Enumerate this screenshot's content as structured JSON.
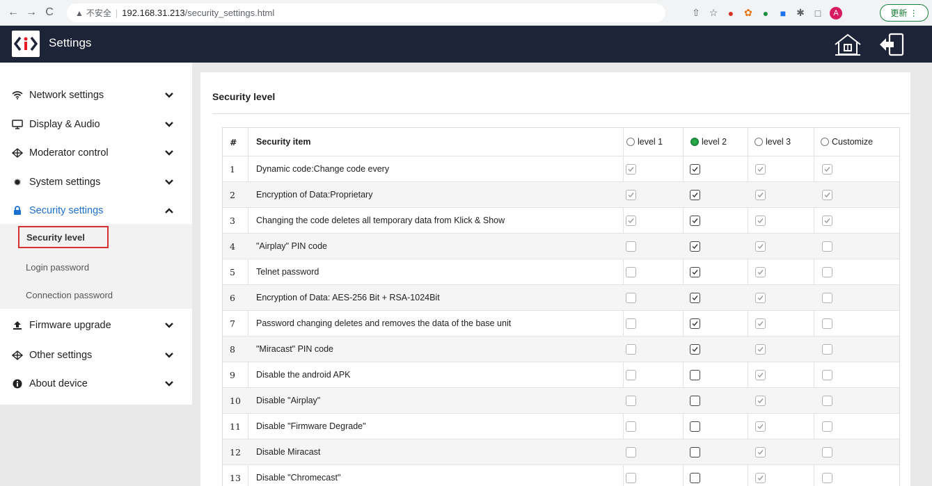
{
  "browser": {
    "security_warning": "不安全",
    "url_host": "192.168.31.213",
    "url_path": "/security_settings.html",
    "profile_initial": "A",
    "update_label": "更新"
  },
  "app": {
    "title": "Settings",
    "logo_text": "<i>"
  },
  "sidebar": {
    "items": [
      {
        "label": "Network settings",
        "icon": "wifi-icon"
      },
      {
        "label": "Display & Audio",
        "icon": "monitor-icon"
      },
      {
        "label": "Moderator control",
        "icon": "diamond-arrows-icon"
      },
      {
        "label": "System settings",
        "icon": "gear-icon"
      },
      {
        "label": "Security settings",
        "icon": "lock-icon"
      },
      {
        "label": "Firmware upgrade",
        "icon": "upload-icon"
      },
      {
        "label": "Other settings",
        "icon": "diamond-arrows-icon"
      },
      {
        "label": "About device",
        "icon": "info-icon"
      }
    ],
    "security_sub": [
      {
        "label": "Security level"
      },
      {
        "label": "Login password"
      },
      {
        "label": "Connection password"
      }
    ]
  },
  "main": {
    "title": "Security level",
    "columns": {
      "num": "#",
      "item": "Security item",
      "level1": "level 1",
      "level2": "level 2",
      "level3": "level 3",
      "custom": "Customize"
    },
    "selected_level": "level 2",
    "rows": [
      {
        "num": "1",
        "item": "Dynamic code:Change code every",
        "l1": true,
        "l2": true,
        "l3": true,
        "custom": true
      },
      {
        "num": "2",
        "item": "Encryption of Data:Proprietary",
        "l1": true,
        "l2": true,
        "l3": true,
        "custom": true
      },
      {
        "num": "3",
        "item": "Changing the code deletes all temporary data from Klick & Show",
        "l1": true,
        "l2": true,
        "l3": true,
        "custom": true
      },
      {
        "num": "4",
        "item": "\"Airplay\" PIN code",
        "l1": false,
        "l2": true,
        "l3": true,
        "custom": false
      },
      {
        "num": "5",
        "item": "Telnet password",
        "l1": false,
        "l2": true,
        "l3": true,
        "custom": false
      },
      {
        "num": "6",
        "item": "Encryption of Data: AES-256 Bit + RSA-1024Bit",
        "l1": false,
        "l2": true,
        "l3": true,
        "custom": false
      },
      {
        "num": "7",
        "item": "Password changing deletes and removes the data of the base unit",
        "l1": false,
        "l2": true,
        "l3": true,
        "custom": false
      },
      {
        "num": "8",
        "item": "\"Miracast\" PIN code",
        "l1": false,
        "l2": true,
        "l3": true,
        "custom": false
      },
      {
        "num": "9",
        "item": "Disable the android APK",
        "l1": false,
        "l2": false,
        "l3": true,
        "custom": false
      },
      {
        "num": "10",
        "item": "Disable \"Airplay\"",
        "l1": false,
        "l2": false,
        "l3": true,
        "custom": false
      },
      {
        "num": "11",
        "item": "Disable \"Firmware Degrade\"",
        "l1": false,
        "l2": false,
        "l3": true,
        "custom": false
      },
      {
        "num": "12",
        "item": "Disable Miracast",
        "l1": false,
        "l2": false,
        "l3": true,
        "custom": false
      },
      {
        "num": "13",
        "item": "Disable \"Chromecast\"",
        "l1": false,
        "l2": false,
        "l3": true,
        "custom": false
      }
    ]
  },
  "colors": {
    "header_bg": "#1e2437",
    "active_blue": "#1a6fd1",
    "selected_outline": "#d32f2f",
    "radio_selected": "#1f9a3e"
  }
}
